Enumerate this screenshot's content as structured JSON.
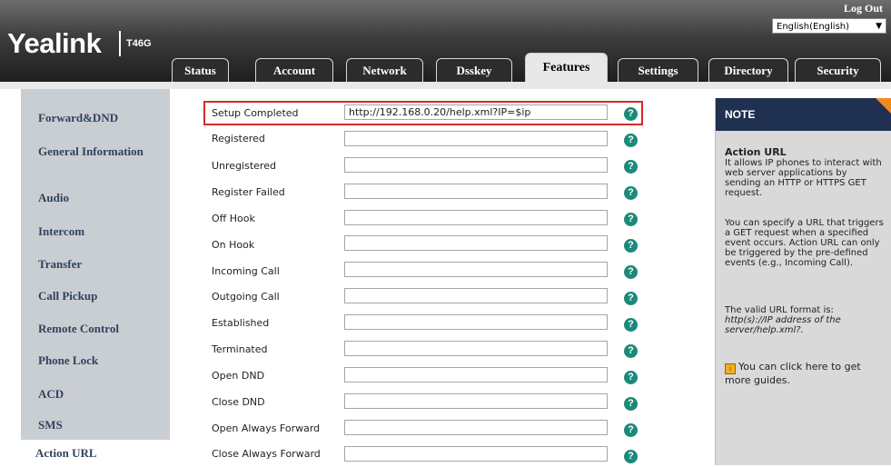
{
  "header": {
    "brand": "Yealink",
    "model": "T46G",
    "logout": "Log Out",
    "language": "English(English)"
  },
  "tabs": [
    {
      "label": "Status"
    },
    {
      "label": "Account"
    },
    {
      "label": "Network"
    },
    {
      "label": "Dsskey"
    },
    {
      "label": "Features",
      "active": true
    },
    {
      "label": "Settings"
    },
    {
      "label": "Directory"
    },
    {
      "label": "Security"
    }
  ],
  "sidebar": {
    "items": [
      {
        "label": "Forward&DND"
      },
      {
        "label": "General Information"
      },
      {
        "label": "Audio"
      },
      {
        "label": "Intercom"
      },
      {
        "label": "Transfer"
      },
      {
        "label": "Call Pickup"
      },
      {
        "label": "Remote Control"
      },
      {
        "label": "Phone Lock"
      },
      {
        "label": "ACD"
      },
      {
        "label": "SMS"
      },
      {
        "label": "Action URL",
        "active": true
      }
    ]
  },
  "rows": [
    {
      "label": "Setup Completed",
      "value": "http://192.168.0.20/help.xml?IP=$ip"
    },
    {
      "label": "Registered",
      "value": ""
    },
    {
      "label": "Unregistered",
      "value": ""
    },
    {
      "label": "Register Failed",
      "value": ""
    },
    {
      "label": "Off Hook",
      "value": ""
    },
    {
      "label": "On Hook",
      "value": ""
    },
    {
      "label": "Incoming Call",
      "value": ""
    },
    {
      "label": "Outgoing Call",
      "value": ""
    },
    {
      "label": "Established",
      "value": ""
    },
    {
      "label": "Terminated",
      "value": ""
    },
    {
      "label": "Open DND",
      "value": ""
    },
    {
      "label": "Close DND",
      "value": ""
    },
    {
      "label": "Open Always Forward",
      "value": ""
    },
    {
      "label": "Close Always Forward",
      "value": ""
    }
  ],
  "help_glyph": "?",
  "note": {
    "title": "NOTE",
    "heading": "Action URL",
    "p1": "It allows IP phones to interact with web server applications by sending an HTTP or HTTPS GET request.",
    "p2": "You can specify a URL that triggers a GET request when a specified event occurs. Action URL can only be triggered by the pre-defined events (e.g., Incoming Call).",
    "p3_prefix": "The valid URL format is:",
    "p3_format": "http(s)://IP address of the server/help.xml?.",
    "p4": "You can click here to get more guides."
  },
  "colors": {
    "nav_text": "#30435c",
    "help_icon": "#1a8a7a",
    "highlight": "#d82828",
    "note_header": "#1f3050",
    "note_corner": "#f08a1c"
  }
}
